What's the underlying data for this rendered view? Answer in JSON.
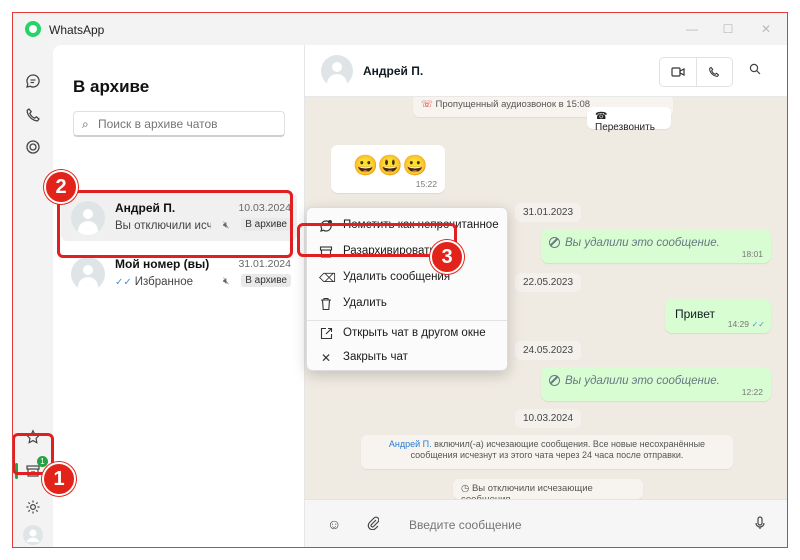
{
  "app": {
    "title": "WhatsApp"
  },
  "archive": {
    "title": "В архиве",
    "search_placeholder": "Поиск в архиве чатов",
    "chats": [
      {
        "name": "Андрей П.",
        "date": "10.03.2024",
        "preview": "Вы отключили исчезающие сообщения.",
        "badge": "В архиве"
      },
      {
        "name": "Мой номер (вы)",
        "date": "31.01.2024",
        "preview": "Избранное",
        "badge": "В архиве"
      }
    ]
  },
  "conversation": {
    "name": "Андрей П.",
    "missed_call": "Пропущенный аудиозвонок в 15:08",
    "call_back": "Перезвонить",
    "emoji_message": "😀😃😀",
    "emoji_time": "15:22",
    "messages": [
      {
        "date": "31.01.2023",
        "text": "Вы удалили это сообщение.",
        "time": "18:01"
      },
      {
        "date": "22.05.2023",
        "text": "Привет",
        "time": "14:29"
      },
      {
        "date": "24.05.2023",
        "text": "Вы удалили это сообщение.",
        "time": "12:22"
      }
    ],
    "date_last": "10.03.2024",
    "sys_enabled_name": "Андрей П.",
    "sys_enabled_text": " включил(-а) исчезающие сообщения. Все новые несохранённые сообщения исчезнут из этого чата через 24 часа после отправки.",
    "sys_disabled": "Вы отключили исчезающие сообщения.",
    "composer_placeholder": "Введите сообщение"
  },
  "context_menu": {
    "items": [
      {
        "label": "Пометить как непрочитанное",
        "icon": "unread-icon"
      },
      {
        "label": "Разархивировать",
        "icon": "unarchive-icon"
      },
      {
        "label": "Удалить сообщения",
        "icon": "clear-icon"
      },
      {
        "label": "Удалить",
        "icon": "trash-icon"
      },
      {
        "label": "Открыть чат в другом окне",
        "icon": "open-window-icon"
      },
      {
        "label": "Закрыть чат",
        "icon": "close-icon"
      }
    ]
  },
  "annotations": {
    "step1": "1",
    "step2": "2",
    "step3": "3"
  },
  "colors": {
    "accent": "#25a244",
    "highlight": "#e02020",
    "outgoing": "#d9fdd3",
    "chat_bg": "#efeae2"
  },
  "archive_badge_count": "1"
}
